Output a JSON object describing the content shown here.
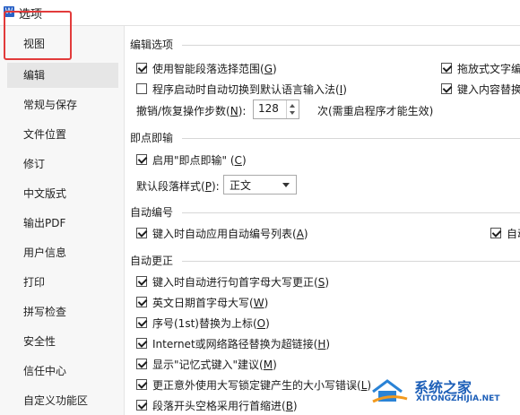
{
  "window": {
    "title": "选项",
    "app_icon": "W"
  },
  "sidebar": {
    "items": [
      {
        "label": "视图"
      },
      {
        "label": "编辑"
      },
      {
        "label": "常规与保存"
      },
      {
        "label": "文件位置"
      },
      {
        "label": "修订"
      },
      {
        "label": "中文版式"
      },
      {
        "label": "输出PDF"
      },
      {
        "label": "用户信息"
      },
      {
        "label": "打印"
      },
      {
        "label": "拼写检查"
      },
      {
        "label": "安全性"
      },
      {
        "label": "信任中心"
      },
      {
        "label": "自定义功能区"
      }
    ],
    "active_index": 1,
    "highlight_color": "#e23b3b"
  },
  "edit_options": {
    "title": "编辑选项",
    "smart_select": {
      "text": "使用智能段落选择范围(",
      "key": "G",
      "end": ")",
      "checked": true
    },
    "drag_drop": {
      "text": "拖放式文字编",
      "checked": true
    },
    "auto_switch_ime": {
      "text": "程序启动时自动切换到默认语言输入法(",
      "key": "I",
      "end": ")",
      "checked": false
    },
    "typing_replace": {
      "text": "键入内容替换",
      "checked": true
    },
    "undo_label": {
      "text": "撤销/恢复操作步数(",
      "key": "N",
      "end": "):"
    },
    "undo_steps": "128",
    "undo_suffix": "次(需重启程序才能生效)"
  },
  "click_type": {
    "title": "即点即输",
    "enable": {
      "text": "启用\"即点即输\" (",
      "key": "C",
      "end": ")",
      "checked": true
    },
    "default_style_label": {
      "text": "默认段落样式(",
      "key": "P",
      "end": "):"
    },
    "default_style_value": "正文"
  },
  "auto_numbering": {
    "title": "自动编号",
    "auto_list": {
      "text": "键入时自动应用自动编号列表(",
      "key": "A",
      "end": ")",
      "checked": true
    },
    "right_partial": {
      "text": "自动",
      "checked": true
    }
  },
  "autocorrect": {
    "title": "自动更正",
    "items": [
      {
        "text": "键入时自动进行句首字母大写更正(",
        "key": "S",
        "end": ")",
        "checked": true
      },
      {
        "text": "英文日期首字母大写(",
        "key": "W",
        "end": ")",
        "checked": true
      },
      {
        "text": "序号(1st)替换为上标(",
        "key": "O",
        "end": ")",
        "checked": true
      },
      {
        "text": "Internet或网络路径替换为超链接(",
        "key": "H",
        "end": ")",
        "checked": true
      },
      {
        "text": "显示\"记忆式键入\"建议(",
        "key": "M",
        "end": ")",
        "checked": true
      },
      {
        "text": "更正意外使用大写锁定键产生的大小写错误(",
        "key": "L",
        "end": ")",
        "checked": true
      },
      {
        "text": "段落开头空格采用行首缩进(",
        "key": "B",
        "end": ")",
        "checked": true
      }
    ]
  },
  "watermark": {
    "name": "系统之家",
    "url": "XITONGZHIJIA.NET"
  }
}
